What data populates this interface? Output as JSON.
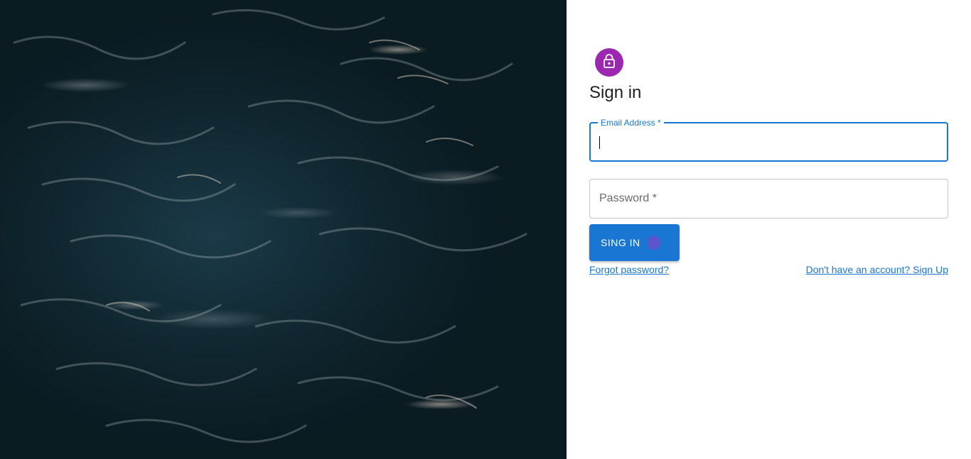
{
  "hero": {
    "image": "dark-ocean-water-photo"
  },
  "signin": {
    "icon": "lock-icon",
    "title": "Sign in",
    "email": {
      "label": "Email Address *",
      "value": ""
    },
    "password": {
      "label": "Password *",
      "value": ""
    },
    "submit_label": "SING IN",
    "forgot_link": "Forgot password?",
    "signup_link": "Don't have an account? Sign Up"
  },
  "colors": {
    "accent": "#1976d2",
    "avatar": "#9c27b0",
    "hero_dark": "#10252e"
  }
}
